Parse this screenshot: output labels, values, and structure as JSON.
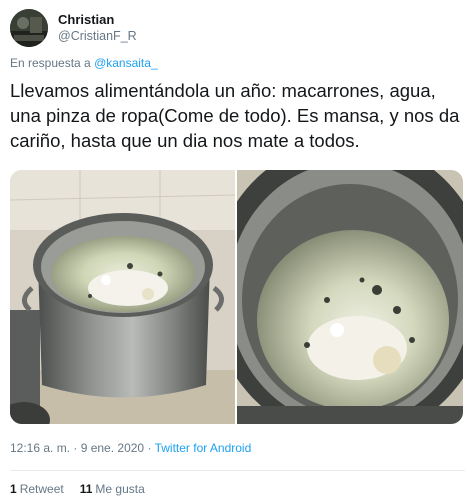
{
  "author": {
    "name": "Christian",
    "handle": "@CristianF_R"
  },
  "reply": {
    "prefix": "En respuesta a",
    "mention": "@kansaita_"
  },
  "tweet": {
    "text": "Llevamos alimentándola un año: macarrones, agua, una pinza de ropa(Come de todo). Es mansa, y nos da cariño, hasta que un dia nos mate a todos."
  },
  "media": {
    "photos": [
      {
        "icon": "pot-photo-left"
      },
      {
        "icon": "pot-photo-right"
      }
    ]
  },
  "meta": {
    "time": "12:16 a. m. · 9 ene. 2020",
    "separator": "·",
    "source": "Twitter for Android"
  },
  "stats": {
    "retweets_count": "1",
    "retweets_label": "Retweet",
    "likes_count": "11",
    "likes_label": "Me gusta"
  },
  "colors": {
    "link": "#1da1f2",
    "secondary_text": "#657786",
    "primary_text": "#14171a",
    "divider": "#e6ecf0"
  }
}
